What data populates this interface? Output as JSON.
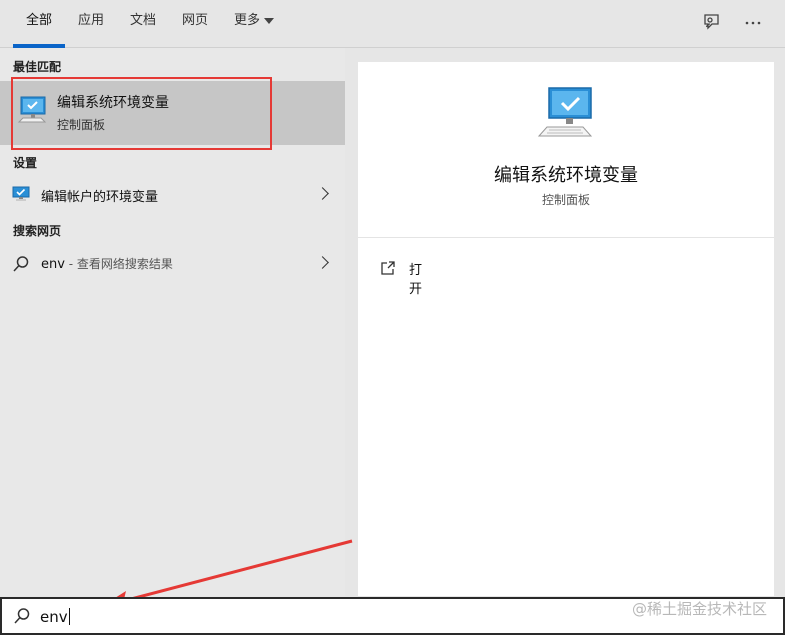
{
  "tabs": [
    {
      "label": "全部",
      "active": true
    },
    {
      "label": "应用"
    },
    {
      "label": "文档"
    },
    {
      "label": "网页"
    },
    {
      "label": "更多"
    }
  ],
  "top_icons": [
    "feedback-icon",
    "more-options-icon"
  ],
  "sections": {
    "best_match": "最佳匹配",
    "settings": "设置",
    "web": "搜索网页"
  },
  "best_match": {
    "title": "编辑系统环境变量",
    "subtitle": "控制面板",
    "icon": "computer-monitor-icon"
  },
  "settings_item": {
    "label": "编辑帐户的环境变量",
    "icon": "monitor-settings-icon"
  },
  "web_item": {
    "query": "env",
    "suffix": " - 查看网络搜索结果",
    "icon": "search-icon"
  },
  "detail": {
    "title": "编辑系统环境变量",
    "subtitle": "控制面板",
    "actions": [
      {
        "label": "打开",
        "icon": "open-icon"
      }
    ]
  },
  "search": {
    "value": "env",
    "icon": "search-icon"
  },
  "watermark": "@稀土掘金技术社区",
  "colors": {
    "accent": "#0a64c8",
    "highlight_box": "#e53935",
    "arrow": "#e53935",
    "selected_bg": "#c6c6c6"
  }
}
